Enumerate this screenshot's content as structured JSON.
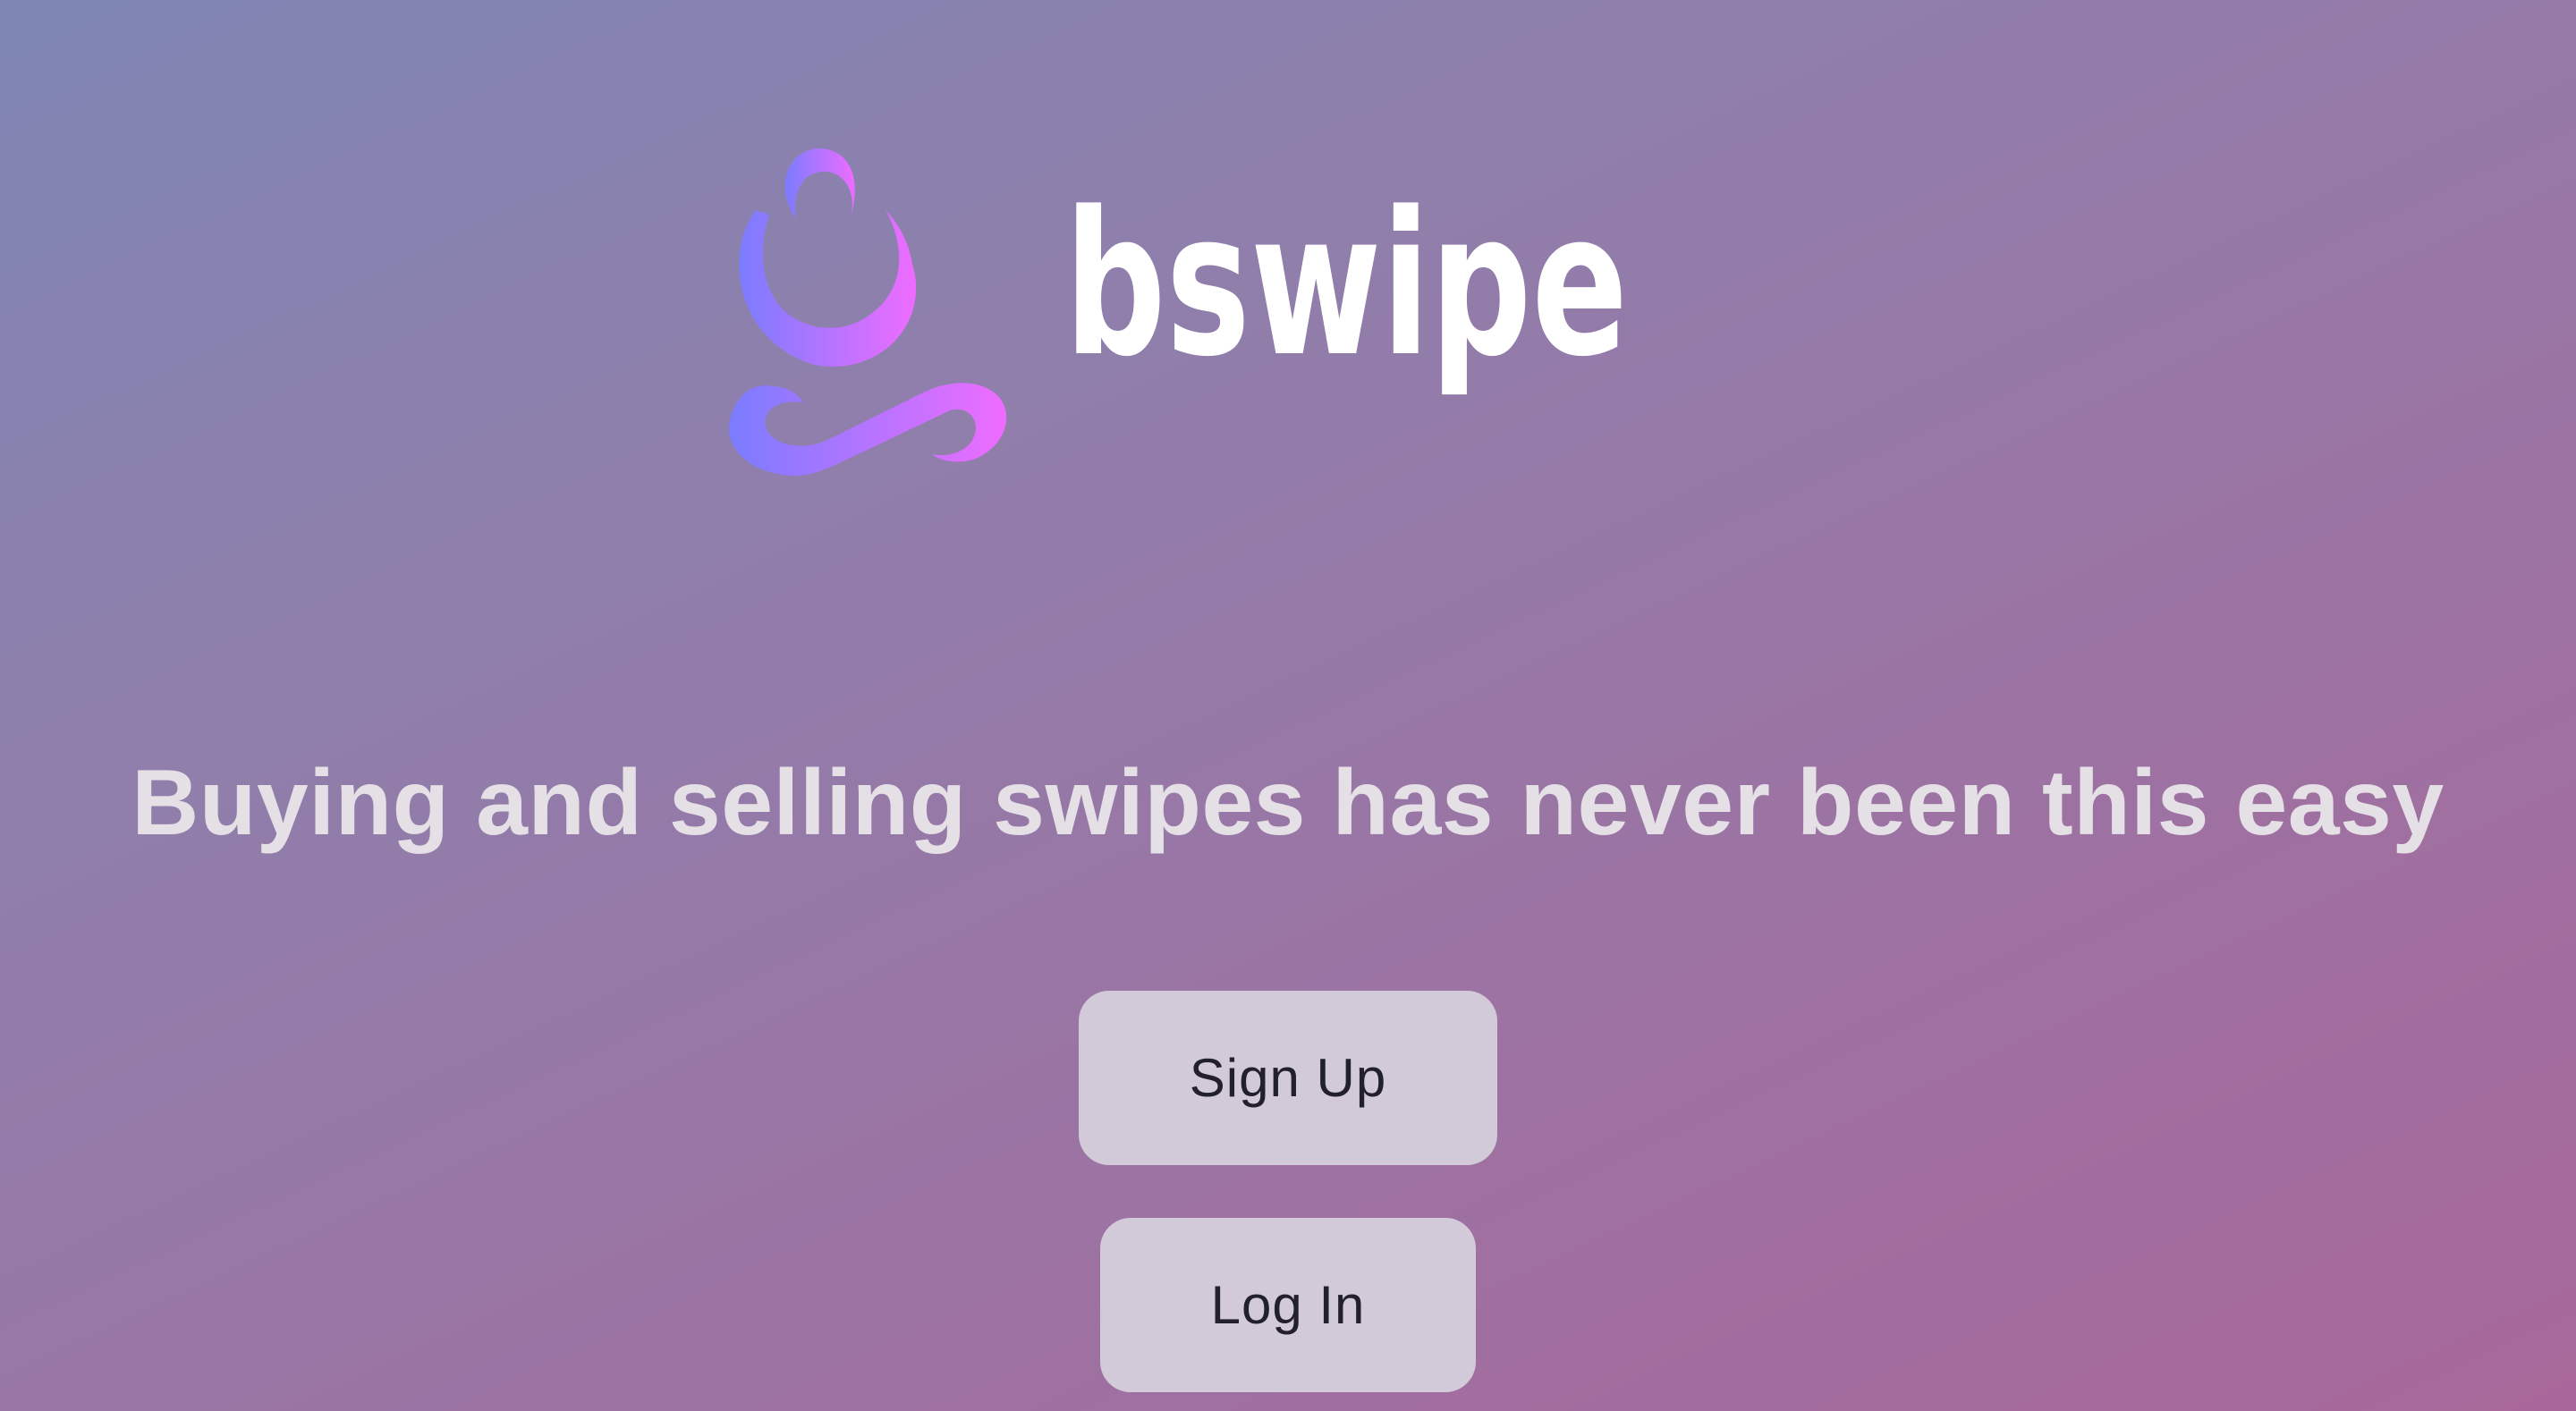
{
  "brand": {
    "name": "bswipe",
    "logo_icon": "meditating-figure-logo",
    "gradient_start": "#7b7cff",
    "gradient_end": "#ee6cff"
  },
  "hero": {
    "tagline": "Buying and selling swipes has never been this easy"
  },
  "actions": {
    "signup_label": "Sign Up",
    "login_label": "Log In"
  },
  "colors": {
    "background_start": "#7f86b4",
    "background_end": "#a8679a",
    "button_bg": "#d3cad9",
    "button_text": "#22202a",
    "tagline_text": "#e4e0e6"
  }
}
